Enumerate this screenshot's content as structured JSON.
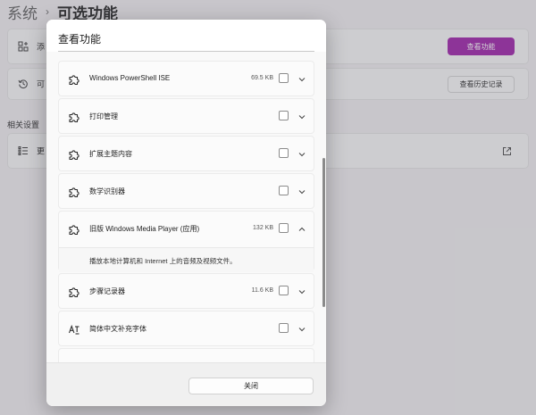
{
  "background": {
    "breadcrumb": {
      "parent": "系统",
      "separator": "›",
      "current": "可选功能"
    },
    "add_card": {
      "label_visible": "添",
      "button_label": "查看功能"
    },
    "history_card": {
      "label_visible": "可",
      "button_label": "查看历史记录"
    },
    "related_settings_label": "相关设置",
    "more_card": {
      "label_visible": "更"
    }
  },
  "dialog": {
    "title": "查看功能",
    "close_label": "关闭",
    "features": [
      {
        "name": "Windows PowerShell ISE",
        "size": "69.5 KB",
        "icon": "puzzle-icon",
        "expanded": false
      },
      {
        "name": "打印管理",
        "size": "",
        "icon": "puzzle-icon",
        "expanded": false
      },
      {
        "name": "扩展主题内容",
        "size": "",
        "icon": "puzzle-icon",
        "expanded": false
      },
      {
        "name": "数学识别器",
        "size": "",
        "icon": "puzzle-icon",
        "expanded": false
      },
      {
        "name": "旧版 Windows Media Player (应用)",
        "size": "132 KB",
        "icon": "puzzle-icon",
        "expanded": true,
        "description": "播放本地计算机和 Internet 上的音频及视频文件。"
      },
      {
        "name": "步骤记录器",
        "size": "11.6 KB",
        "icon": "puzzle-icon",
        "expanded": false
      },
      {
        "name": "简体中文补充字体",
        "size": "",
        "icon": "font-icon",
        "expanded": false
      }
    ]
  },
  "colors": {
    "accent": "#9c1aa8"
  }
}
